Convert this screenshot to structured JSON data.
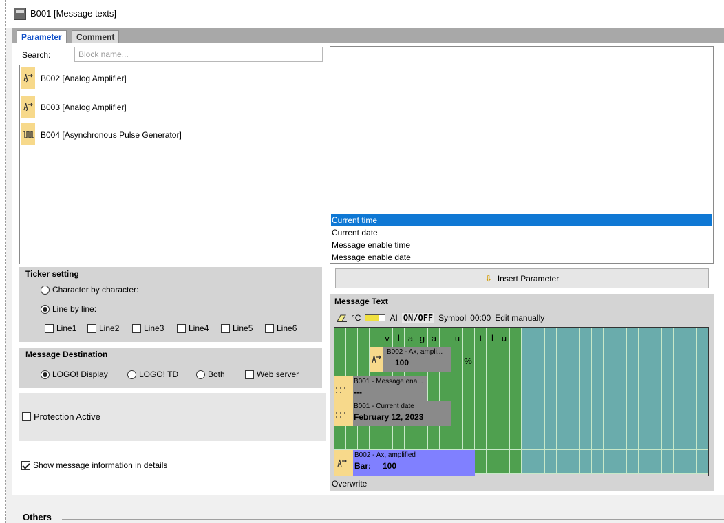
{
  "window": {
    "title": "B001 [Message texts]"
  },
  "tabs": [
    {
      "label": "Parameter",
      "active": true
    },
    {
      "label": "Comment",
      "active": false
    }
  ],
  "search": {
    "label": "Search:",
    "placeholder": "Block name..."
  },
  "blocks": [
    {
      "label": "B002 [Analog Amplifier]",
      "icon": "analog-amplifier-icon"
    },
    {
      "label": "B003 [Analog Amplifier]",
      "icon": "analog-amplifier-icon"
    },
    {
      "label": "B004 [Asynchronous Pulse Generator]",
      "icon": "pulse-generator-icon"
    }
  ],
  "parameters": [
    {
      "label": "Current time",
      "selected": true
    },
    {
      "label": "Current date",
      "selected": false
    },
    {
      "label": "Message enable time",
      "selected": false
    },
    {
      "label": "Message enable date",
      "selected": false
    }
  ],
  "insert_button": {
    "label": "Insert Parameter"
  },
  "ticker": {
    "title": "Ticker setting",
    "option_character": "Character by character:",
    "option_line": "Line by line:",
    "selected": "line",
    "lines": [
      {
        "label": "Line1",
        "checked": false
      },
      {
        "label": "Line2",
        "checked": false
      },
      {
        "label": "Line3",
        "checked": false
      },
      {
        "label": "Line4",
        "checked": false
      },
      {
        "label": "Line5",
        "checked": false
      },
      {
        "label": "Line6",
        "checked": false
      }
    ]
  },
  "message_destination": {
    "title": "Message Destination",
    "options": [
      "LOGO! Display",
      "LOGO! TD",
      "Both"
    ],
    "selected": "LOGO! Display",
    "web_server_label": "Web server",
    "web_server_checked": false
  },
  "protection": {
    "label": "Protection Active",
    "checked": false
  },
  "show_info": {
    "label": "Show message information in details",
    "checked": true
  },
  "message_text": {
    "title": "Message Text",
    "toolbar": {
      "celsius": "°C",
      "ai": "AI",
      "onoff": "ON/OFF",
      "symbol": "Symbol",
      "time": "00:00",
      "edit": "Edit manually"
    },
    "row1_chars": [
      "v",
      "l",
      "a",
      "g",
      "a",
      "u",
      "t",
      "l",
      "u"
    ],
    "blocks": {
      "analog1": {
        "line1": "B002 - Ax, ampli...",
        "line2": "100",
        "suffix": "%"
      },
      "enable": {
        "line1": "B001 - Message ena...",
        "line2": "---"
      },
      "date": {
        "line1": "B001 - Current date",
        "line2": "February 12, 2023"
      },
      "bar": {
        "line1": "B002 - Ax, amplified",
        "line2": "Bar:",
        "value": "100"
      }
    },
    "mode": "Overwrite"
  },
  "others": {
    "label": "Others"
  },
  "colors": {
    "grid_green": "#4fa04f",
    "grid_teal": "#6aacac",
    "selection": "#0f78d4",
    "bar_block": "#8080ff",
    "icon_yellow": "#f7d98b"
  }
}
